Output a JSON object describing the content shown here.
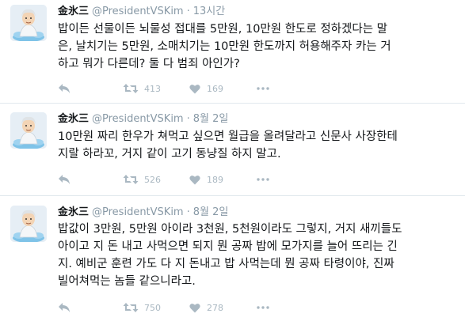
{
  "tweets": [
    {
      "name": "金氷三",
      "handle": "@PresidentVSKim",
      "separator": "·",
      "time": "13시간",
      "lines": [
        "밥이든 선물이든 뇌물성 접대를 5만원, 10만원 한도로 정하겠다는 말",
        "은, 날치기는 5만원, 소매치기는 10만원 한도까지 허용해주자 카는 거",
        "하고 뭐가 다른데? 둘 다 범죄 아인가?"
      ],
      "retweets": "413",
      "likes": "169"
    },
    {
      "name": "金氷三",
      "handle": "@PresidentVSKim",
      "separator": "·",
      "time": "8월 2일",
      "lines": [
        "10만원 짜리 한우가 쳐먹고 싶으면 월급을 올려달라고 신문사 사장한테",
        "지랄 하라꼬, 거지 같이 고기 동냥질 하지 말고."
      ],
      "retweets": "526",
      "likes": "189"
    },
    {
      "name": "金氷三",
      "handle": "@PresidentVSKim",
      "separator": "·",
      "time": "8월 2일",
      "lines": [
        "밥값이 3만원, 5만원 아이라 3천원, 5천원이라도 그렇지, 거지 새끼들도",
        "아이고 지 돈 내고 사먹으면 되지 뭔 공짜 밥에 모가지를 늘어 뜨리는 긴",
        "지. 예비군 훈련 가도 다 지 돈내고 밥 사먹는데 뭔 공짜 타령이야, 진짜",
        "빌어쳐먹는 놈들 같으니라고."
      ],
      "retweets": "750",
      "likes": "278"
    }
  ]
}
